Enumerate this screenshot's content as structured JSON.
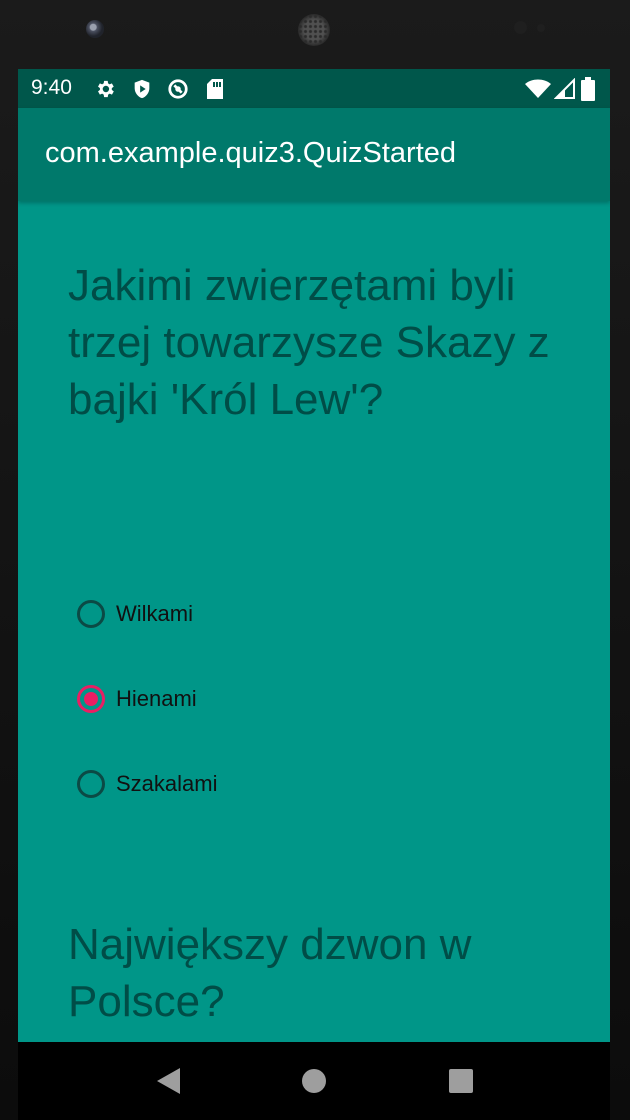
{
  "status_bar": {
    "time": "9:40",
    "left_icons": [
      "gear-icon",
      "play-shield-icon",
      "sync-icon",
      "sd-card-icon"
    ],
    "right_icons": [
      "wifi-icon",
      "signal-icon",
      "battery-icon"
    ]
  },
  "app_bar": {
    "title": "com.example.quiz3.QuizStarted"
  },
  "questions": [
    {
      "text": "Jakimi zwierzętami byli trzej towarzysze Skazy z bajki 'Król Lew'?",
      "options": [
        {
          "label": "Wilkami",
          "selected": false
        },
        {
          "label": "Hienami",
          "selected": true
        },
        {
          "label": "Szakalami",
          "selected": false
        }
      ]
    },
    {
      "text": "Największy dzwon w Polsce?"
    }
  ],
  "colors": {
    "status_bar": "#00574b",
    "app_bar": "#00796b",
    "background": "#009688",
    "question_text": "#004d47",
    "radio_accent": "#e91e63"
  },
  "navigation_bar": {
    "buttons": [
      "back-icon",
      "home-icon",
      "recent-apps-icon"
    ]
  }
}
